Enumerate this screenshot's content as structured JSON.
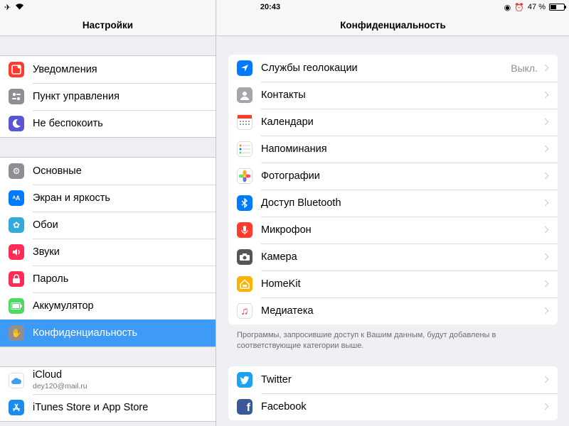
{
  "status": {
    "time": "20:43",
    "battery": "47 %",
    "battery_level": 0.47
  },
  "left": {
    "title": "Настройки",
    "groups": [
      [
        {
          "label": "Уведомления",
          "icon": "notifications-icon",
          "color": "#ff3b30"
        },
        {
          "label": "Пункт управления",
          "icon": "control-center-icon",
          "color": "#8e8e93"
        },
        {
          "label": "Не беспокоить",
          "icon": "moon-icon",
          "color": "#5856d6"
        }
      ],
      [
        {
          "label": "Основные",
          "icon": "gear-icon",
          "color": "#8e8e93"
        },
        {
          "label": "Экран и яркость",
          "icon": "display-icon",
          "color": "#007aff"
        },
        {
          "label": "Обои",
          "icon": "wallpaper-icon",
          "color": "#34aadc"
        },
        {
          "label": "Звуки",
          "icon": "sound-icon",
          "color": "#ff2d55"
        },
        {
          "label": "Пароль",
          "icon": "lock-icon",
          "color": "#ff2d55"
        },
        {
          "label": "Аккумулятор",
          "icon": "battery-icon",
          "color": "#4cd964"
        },
        {
          "label": "Конфиденциальность",
          "icon": "hand-icon",
          "color": "#8e8e93"
        }
      ],
      [
        {
          "label": "iCloud",
          "sub": "dey120@mail.ru",
          "icon": "icloud-icon",
          "color": "#ffffff"
        },
        {
          "label": "iTunes Store и App Store",
          "icon": "appstore-icon",
          "color": "#1a8cf0"
        }
      ]
    ]
  },
  "right": {
    "title": "Конфиденциальность",
    "items": [
      {
        "label": "Службы геолокации",
        "value": "Выкл.",
        "icon": "location-icon",
        "color": "#007aff"
      },
      {
        "label": "Контакты",
        "icon": "contacts-icon",
        "color": "#a5a5aa"
      },
      {
        "label": "Календари",
        "icon": "calendar-icon",
        "color": "#ffffff"
      },
      {
        "label": "Напоминания",
        "icon": "reminders-icon",
        "color": "#ffffff"
      },
      {
        "label": "Фотографии",
        "icon": "photos-icon",
        "color": "#ffffff"
      },
      {
        "label": "Доступ Bluetooth",
        "icon": "bluetooth-icon",
        "color": "#007aff"
      },
      {
        "label": "Микрофон",
        "icon": "microphone-icon",
        "color": "#ff3b30"
      },
      {
        "label": "Камера",
        "icon": "camera-icon",
        "color": "#555555"
      },
      {
        "label": "HomeKit",
        "icon": "homekit-icon",
        "color": "#ffb300"
      },
      {
        "label": "Медиатека",
        "icon": "music-icon",
        "color": "#ffffff"
      }
    ],
    "footer": "Программы, запросившие доступ к Вашим данным, будут добавлены в соответствующие категории выше.",
    "social": [
      {
        "label": "Twitter",
        "icon": "twitter-icon",
        "color": "#1da1f2"
      },
      {
        "label": "Facebook",
        "icon": "facebook-icon",
        "color": "#3b5998"
      }
    ]
  }
}
